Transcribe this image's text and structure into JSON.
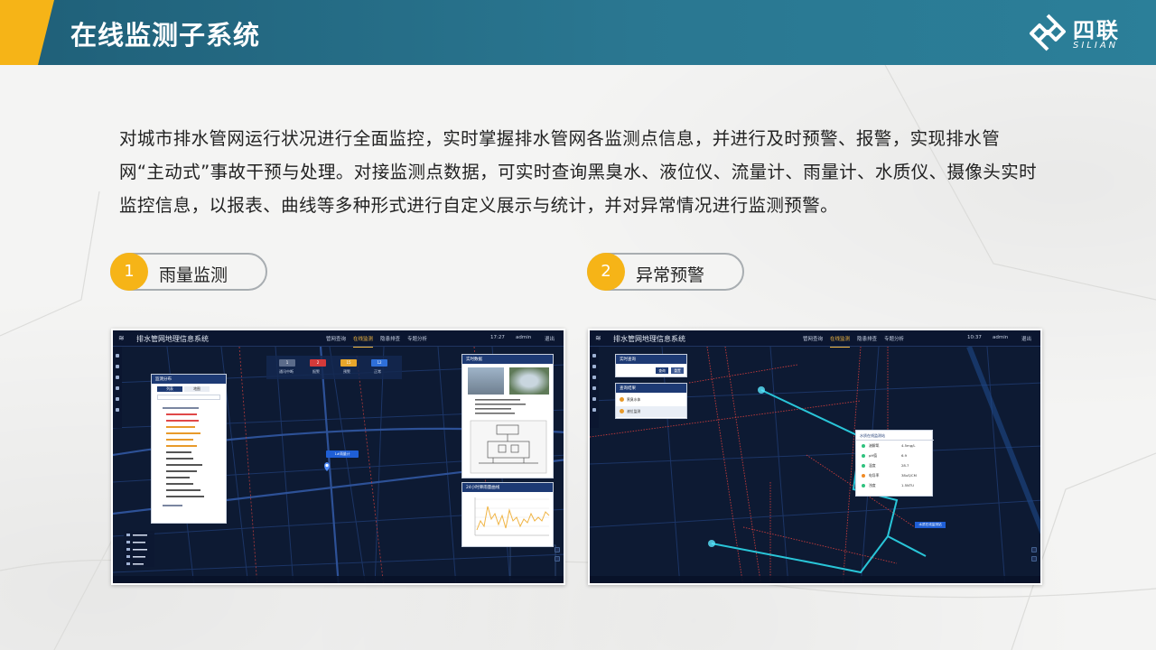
{
  "header": {
    "title": "在线监测子系统",
    "logo_cn": "四联",
    "logo_en": "SILIAN"
  },
  "description": "对城市排水管网运行状况进行全面监控，实时掌握排水管网各监测点信息，并进行及时预警、报警，实现排水管网“主动式”事故干预与处理。对接监测点数据，可实时查询黑臭水、液位仪、流量计、雨量计、水质仪、摄像头实时监控信息，以报表、曲线等多种形式进行自定义展示与统计，并对异常情况进行监测预警。",
  "sections": [
    {
      "number": "1",
      "label": "雨量监测"
    },
    {
      "number": "2",
      "label": "异常预警"
    }
  ],
  "screenshots": {
    "common": {
      "app_title": "排水管网地理信息系统",
      "nav": [
        "管网查询",
        "在线监测",
        "隐患排查",
        "专题分析"
      ],
      "user": "admin",
      "logout": "退出"
    },
    "left": {
      "time": "17:27",
      "stats": [
        {
          "value": "1",
          "label": "通讯中断",
          "color": "#5b6b8a"
        },
        {
          "value": "2",
          "label": "报警",
          "color": "#d43a3a"
        },
        {
          "value": "15",
          "label": "预警",
          "color": "#e8a62b"
        },
        {
          "value": "12",
          "label": "正常",
          "color": "#2e6fd8"
        }
      ],
      "list_panel_title": "监测分布",
      "tabs": [
        "列表",
        "地图"
      ],
      "chart_title": "24小时降雨量曲线",
      "info_title": "实时数据",
      "map_label": "1#雨量计"
    },
    "right": {
      "time": "10:37",
      "query_title": "实时查询",
      "query_buttons": [
        "查询",
        "重置"
      ],
      "result_title": "查询结果",
      "result_items": [
        "黑臭水体",
        "液位监测"
      ],
      "popup_title": "水质在线监测站",
      "popup_rows": [
        {
          "label": "溶解氧",
          "value": "4.5mg/L",
          "color": "#2ec27e"
        },
        {
          "label": "pH值",
          "value": "6.9",
          "color": "#2ec27e"
        },
        {
          "label": "温度",
          "value": "28.7",
          "color": "#2ec27e"
        },
        {
          "label": "电导率",
          "value": "38uS/CM",
          "color": "#f08a24"
        },
        {
          "label": "浊度",
          "value": "1.5NTU",
          "color": "#2ec27e"
        }
      ]
    }
  },
  "colors": {
    "header_teal": "#2a7791",
    "accent_yellow": "#f6b417"
  }
}
